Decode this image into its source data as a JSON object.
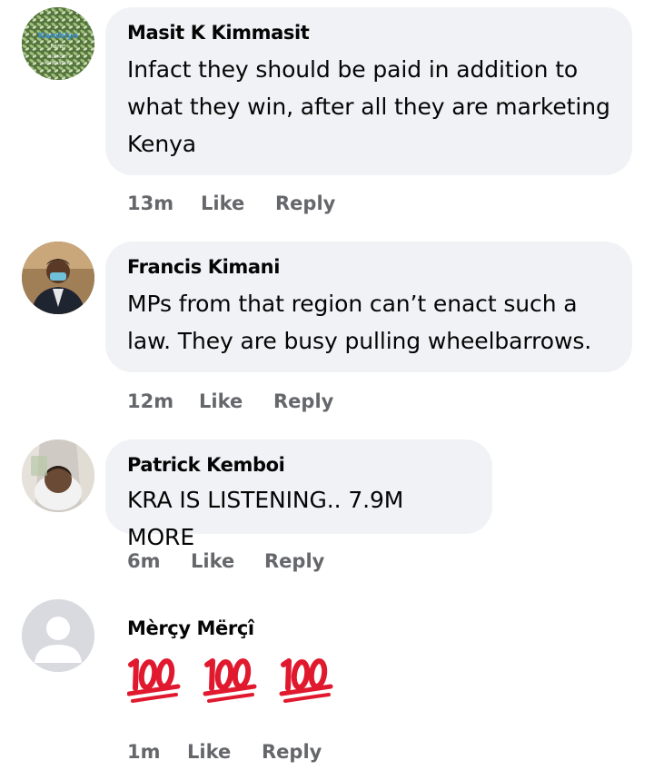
{
  "comments": [
    {
      "author": "Masit K Kimmasit",
      "text": "Infact they should be paid in addition to what they win, after all they are marketing Kenya",
      "time": "13m",
      "avatar_text": [
        "Kambiyo",
        "Farm",
        "SUPPORT",
        "AGRICULTURE"
      ]
    },
    {
      "author": "Francis Kimani",
      "text": "MPs from that region can’t enact such a law. They are busy pulling wheelbarrows.",
      "time": "12m"
    },
    {
      "author": "Patrick Kemboi",
      "text": "KRA IS LISTENING.. 7.9M MORE",
      "time": "6m"
    },
    {
      "author": "Mèrçy Mërçî",
      "time": "1m",
      "emoji_icon": "hundred-points-emoji",
      "emoji_count": 3
    }
  ],
  "actions": {
    "like": "Like",
    "reply": "Reply"
  },
  "colors": {
    "bubble": "#f0f2f5",
    "meta": "#65676b",
    "text": "#050505",
    "emoji_red": "#e0192f"
  }
}
